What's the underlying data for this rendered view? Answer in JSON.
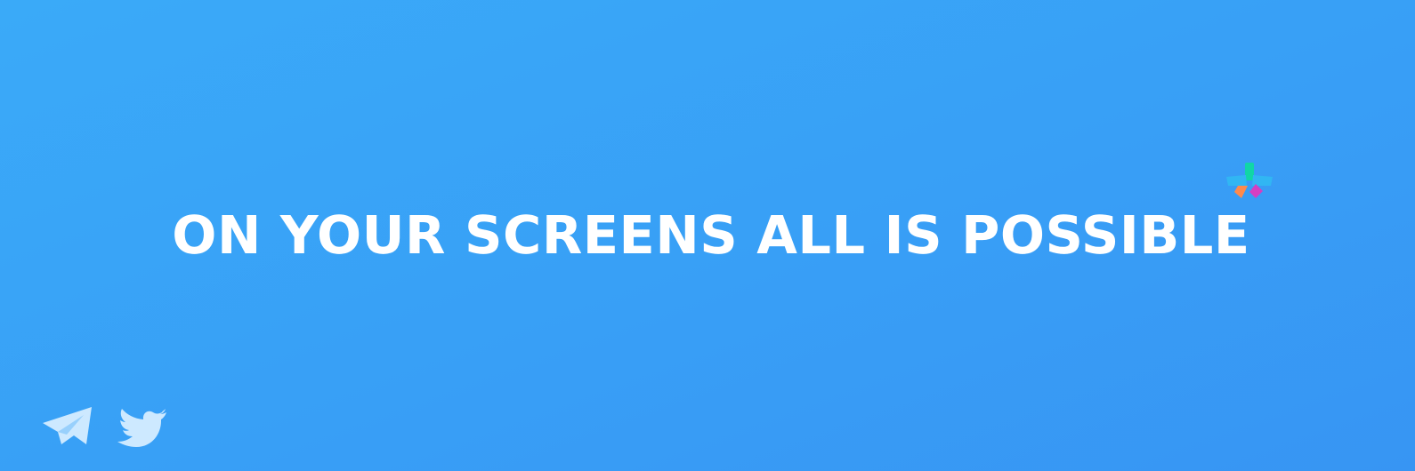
{
  "banner": {
    "headline": "ON YOUR SCREENS ALL IS POSSIBLE"
  },
  "logo": {
    "icon": "sparkle-logo-icon",
    "colors": [
      "#11d6a6",
      "#31b6f3",
      "#ff8a4c",
      "#d43fc2"
    ]
  },
  "social": [
    {
      "icon": "telegram-icon"
    },
    {
      "icon": "twitter-icon"
    }
  ],
  "colors": {
    "background_start": "#3aaaf8",
    "background_end": "#3795f3",
    "text": "#ffffff",
    "social_icon": "#cde9ff"
  }
}
